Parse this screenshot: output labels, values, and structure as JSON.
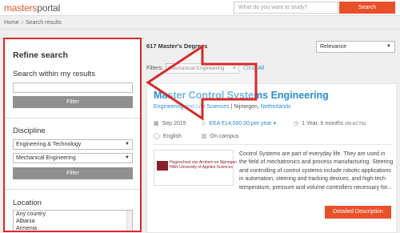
{
  "header": {
    "logo_part1": "masters",
    "logo_part2": "portal",
    "search_placeholder": "What do you want to study?",
    "search_button": "Search"
  },
  "breadcrumb": {
    "home": "Home",
    "separator": "›",
    "current": "Search results"
  },
  "sidebar": {
    "title": "Refine search",
    "search_label": "Search within my results",
    "filter_button_1": "Filter",
    "discipline_label": "Discipline",
    "discipline_select_1": "Engineering & Technology",
    "discipline_select_2": "Mechanical Engineering",
    "filter_button_2": "Filter",
    "location_label": "Location",
    "location_options": [
      "Any country",
      "Albania",
      "Armenia"
    ]
  },
  "results": {
    "count": "617 Master's Degrees",
    "sort_value": "Relevance",
    "filters_label": "Filters:",
    "chip_label": "Mechanical Engineering",
    "clear_all": "Clear All"
  },
  "card": {
    "title": "Master Control Systems Engineering",
    "field": "Engineering and Life Sciences",
    "city_sep": "|",
    "city": "Nijmegen,",
    "country": "Netherlands",
    "start": "Sep 2015",
    "fee": "EEA €14,000.00 per year",
    "duration": "1 Year, 6 months",
    "ects": "(90 ECTS)",
    "language": "English",
    "mode": "On campus",
    "school_logo_line1": "Hogeschool van Arnhem en Nijmegen",
    "school_logo_line2": "HAN University of Applied Sciences",
    "description": "Control Systems are part of everyday life. They are used in the field of mechatronics and process manufacturing. Steering and controlling of control systems include robotic applications in automation, steering and tracking devices, and high-tech temperature, pressure and volume controllers necessary for...",
    "detail_button": "Detailed Description"
  },
  "colors": {
    "accent": "#e8502a",
    "link": "#2a8fd0",
    "highlight": "#d72a2a"
  }
}
